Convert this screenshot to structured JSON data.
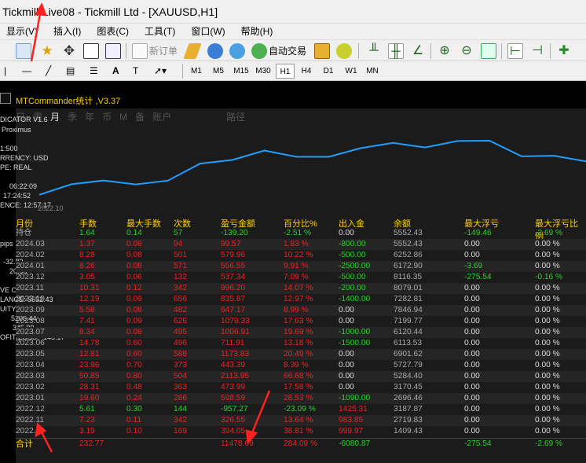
{
  "window": {
    "title": "Tickmill-Live08 - Tickmill Ltd - [XAUUSD,H1]"
  },
  "menu": [
    "显示(V)",
    "插入(I)",
    "图表(C)",
    "工具(T)",
    "窗口(W)",
    "帮助(H)"
  ],
  "toolbar": {
    "new_order": "新订单",
    "auto_trade": "自动交易"
  },
  "timeframes": [
    "M1",
    "M5",
    "M15",
    "M30",
    "H1",
    "H4",
    "D1",
    "W1",
    "MN"
  ],
  "active_timeframe": "H1",
  "draw_tools": {
    "text": "A",
    "text_label": "T"
  },
  "panel": {
    "title": "MTCommander统计 ,V3.37",
    "tabs": [
      "日",
      "周",
      "月",
      "季",
      "年",
      "币",
      "M",
      "备",
      "账户",
      "路径"
    ],
    "active_tab": "月",
    "x_label": "2022.10"
  },
  "overlay": {
    "indicator": "DICATOR V1.6",
    "proximus": "Proximus",
    "leverage": "1:500",
    "currency": "RRENCY:  USD",
    "type": "PE:  REAL",
    "time1": "06:22:09",
    "time2": "17:24:52",
    "difference": "ENCE:  12:57:17",
    "pips": "pips",
    "v1": "-32.82",
    "v2": "20.90",
    "orders": "VE ORDERS:  1   57",
    "balance": "LANCE:  5552.43",
    "equity": "UITY:  5407.26",
    "v3": "5206.44",
    "v4": "345.99",
    "profit": "OFIT/LOSS:  -145.17"
  },
  "table": {
    "headers": [
      "月份",
      "手数",
      "最大手数",
      "次数",
      "盈亏金额",
      "百分比%",
      "出入金",
      "余额",
      "最大浮亏",
      "最大浮亏比例"
    ],
    "rows": [
      [
        "持仓",
        "1.64",
        "0.14",
        "57",
        "-139.20",
        "-2.51 %",
        "0.00",
        "5552.43",
        "-149.46",
        "-2.69 %"
      ],
      [
        "2024.03",
        "1.37",
        "0.08",
        "94",
        "99.57",
        "1.83 %",
        "-800.00",
        "5552.43",
        "0.00",
        "0.00 %"
      ],
      [
        "2024.02",
        "8.28",
        "0.08",
        "501",
        "579.96",
        "10.22 %",
        "-500.00",
        "6252.86",
        "0.00",
        "0.00 %"
      ],
      [
        "2024.01",
        "8.26",
        "0.08",
        "571",
        "556.55",
        "9.91 %",
        "-2500.00",
        "6172.90",
        "-3.69",
        "0.00 %"
      ],
      [
        "2023.12",
        "3.05",
        "0.06",
        "132",
        "537.34",
        "7.09 %",
        "-500.00",
        "8116.35",
        "-275.54",
        "-0.16 %"
      ],
      [
        "2023.11",
        "10.31",
        "0.12",
        "342",
        "996.20",
        "14.07 %",
        "-200.00",
        "8079.01",
        "0.00",
        "0.00 %"
      ],
      [
        "2023.10",
        "12.19",
        "0.09",
        "656",
        "835.87",
        "12.97 %",
        "-1400.00",
        "7282.81",
        "0.00",
        "0.00 %"
      ],
      [
        "2023.09",
        "5.58",
        "0.08",
        "482",
        "647.17",
        "8.99 %",
        "0.00",
        "7846.94",
        "0.00",
        "0.00 %"
      ],
      [
        "2023.08",
        "7.41",
        "0.09",
        "626",
        "1079.33",
        "17.63 %",
        "0.00",
        "7199.77",
        "0.00",
        "0.00 %"
      ],
      [
        "2023.07",
        "8.34",
        "0.08",
        "495",
        "1006.91",
        "19.69 %",
        "-1000.00",
        "6120.44",
        "0.00",
        "0.00 %"
      ],
      [
        "2023.06",
        "14.78",
        "0.60",
        "496",
        "711.91",
        "13.18 %",
        "-1500.00",
        "6113.53",
        "0.00",
        "0.00 %"
      ],
      [
        "2023.05",
        "12.81",
        "0.60",
        "588",
        "1173.83",
        "20.49 %",
        "0.00",
        "6901.62",
        "0.00",
        "0.00 %"
      ],
      [
        "2023.04",
        "23.96",
        "0.70",
        "373",
        "443.39",
        "8.39 %",
        "0.00",
        "5727.79",
        "0.00",
        "0.00 %"
      ],
      [
        "2023.03",
        "50.85",
        "0.80",
        "504",
        "2113.95",
        "66.68 %",
        "0.00",
        "5284.40",
        "0.00",
        "0.00 %"
      ],
      [
        "2023.02",
        "28.31",
        "0.48",
        "363",
        "473.99",
        "17.58 %",
        "0.00",
        "3170.45",
        "0.00",
        "0.00 %"
      ],
      [
        "2023.01",
        "19.60",
        "0.24",
        "286",
        "598.59",
        "28.53 %",
        "-1090.00",
        "2696.46",
        "0.00",
        "0.00 %"
      ],
      [
        "2022.12",
        "5.61",
        "0.30",
        "144",
        "-957.27",
        "-23.09 %",
        "1425.31",
        "3187.87",
        "0.00",
        "0.00 %"
      ],
      [
        "2022.11",
        "7.23",
        "0.11",
        "342",
        "326.55",
        "13.64 %",
        "983.85",
        "2719.83",
        "0.00",
        "0.00 %"
      ],
      [
        "2022.10",
        "3.19",
        "0.10",
        "169",
        "394.05",
        "38.81 %",
        "999.97",
        "1409.43",
        "0.00",
        "0.00 %"
      ]
    ],
    "total": [
      "合计",
      "232.77",
      "",
      "",
      "11478.69",
      "284.09 %",
      "-6080.87",
      "",
      "-275.54",
      "-2.69 %"
    ]
  },
  "equity_curve": [
    1409,
    2719,
    3188,
    2696,
    3170,
    5284,
    5728,
    6902,
    6114,
    6120,
    7200,
    7847,
    7283,
    8079,
    8116,
    6173,
    6253,
    5552
  ],
  "colors": {
    "gain": "#ee2222",
    "loss": "#2bd22b",
    "header": "#ffd000",
    "curve": "#1e9fff"
  }
}
